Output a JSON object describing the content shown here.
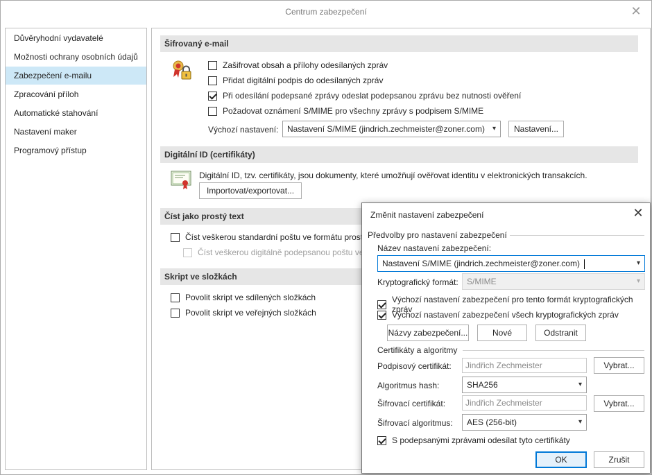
{
  "window": {
    "title": "Centrum zabezpečení",
    "close_glyph": "✕"
  },
  "nav": {
    "items": [
      {
        "label": "Důvěryhodní vydavatelé",
        "selected": false
      },
      {
        "label": "Možnosti ochrany osobních údajů",
        "selected": false
      },
      {
        "label": "Zabezpečení e-mailu",
        "selected": true
      },
      {
        "label": "Zpracování příloh",
        "selected": false
      },
      {
        "label": "Automatické stahování",
        "selected": false
      },
      {
        "label": "Nastavení maker",
        "selected": false
      },
      {
        "label": "Programový přístup",
        "selected": false
      }
    ]
  },
  "encrypted": {
    "header": "Šifrovaný e-mail",
    "options": [
      {
        "label": "Zašifrovat obsah a přílohy odesílaných zpráv",
        "checked": false
      },
      {
        "label": "Přidat digitální podpis do odesílaných zpráv",
        "checked": false
      },
      {
        "label": "Při odesílání podepsané zprávy odeslat podepsanou zprávu bez nutnosti ověření",
        "checked": true
      },
      {
        "label": "Požadovat oznámení S/MIME pro všechny zprávy s podpisem S/MIME",
        "checked": false
      }
    ],
    "default_label": "Výchozí nastavení:",
    "default_value": "Nastavení S/MIME (jindrich.zechmeister@zoner.com)",
    "settings_button": "Nastavení..."
  },
  "digital_id": {
    "header": "Digitální ID (certifikáty)",
    "description": "Digitální ID, tzv. certifikáty, jsou dokumenty, které umožňují ověřovat identitu v elektronických transakcích.",
    "import_button": "Importovat/exportovat..."
  },
  "plaintext": {
    "header": "Číst jako prostý text",
    "options": [
      {
        "label": "Číst veškerou standardní poštu ve formátu prosté",
        "checked": false,
        "disabled": false
      },
      {
        "label": "Číst veškerou digitálně podepsanou poštu ve f",
        "checked": false,
        "disabled": true
      }
    ]
  },
  "script": {
    "header": "Skript ve složkách",
    "options": [
      {
        "label": "Povolit skript ve sdílených složkách",
        "checked": false
      },
      {
        "label": "Povolit skript ve veřejných složkách",
        "checked": false
      }
    ]
  },
  "dialog": {
    "title": "Změnit nastavení zabezpečení",
    "close_glyph": "✕",
    "prefs_group": "Předvolby pro nastavení zabezpečení",
    "name_label": "Název nastavení zabezpečení:",
    "name_value": "Nastavení S/MIME (jindrich.zechmeister@zoner.com)",
    "crypto_format_label": "Kryptografický formát:",
    "crypto_format_value": "S/MIME",
    "default_for_format": {
      "label": "Výchozí nastavení zabezpečení pro tento formát kryptografických zpráv",
      "checked": true
    },
    "default_for_all": {
      "label": "Výchozí nastavení zabezpečení všech kryptografických zpráv",
      "checked": true
    },
    "labels_button": "Názvy zabezpečení...",
    "new_button": "Nové",
    "delete_button": "Odstranit",
    "certs_group": "Certifikáty a algoritmy",
    "signing_cert_label": "Podpisový certifikát:",
    "signing_cert_value": "Jindřich Zechmeister",
    "choose_button_1": "Vybrat...",
    "hash_label": "Algoritmus hash:",
    "hash_value": "SHA256",
    "encrypt_cert_label": "Šifrovací certifikát:",
    "encrypt_cert_value": "Jindřich Zechmeister",
    "choose_button_2": "Vybrat...",
    "encrypt_alg_label": "Šifrovací algoritmus:",
    "encrypt_alg_value": "AES (256-bit)",
    "send_certs": {
      "label": "S podepsanými zprávami odesílat tyto certifikáty",
      "checked": true
    },
    "ok_button": "OK",
    "cancel_button": "Zrušit"
  },
  "icons": {
    "encryption": "lock-seal-icon",
    "certificate": "certificate-icon",
    "dropdown": "▾"
  }
}
